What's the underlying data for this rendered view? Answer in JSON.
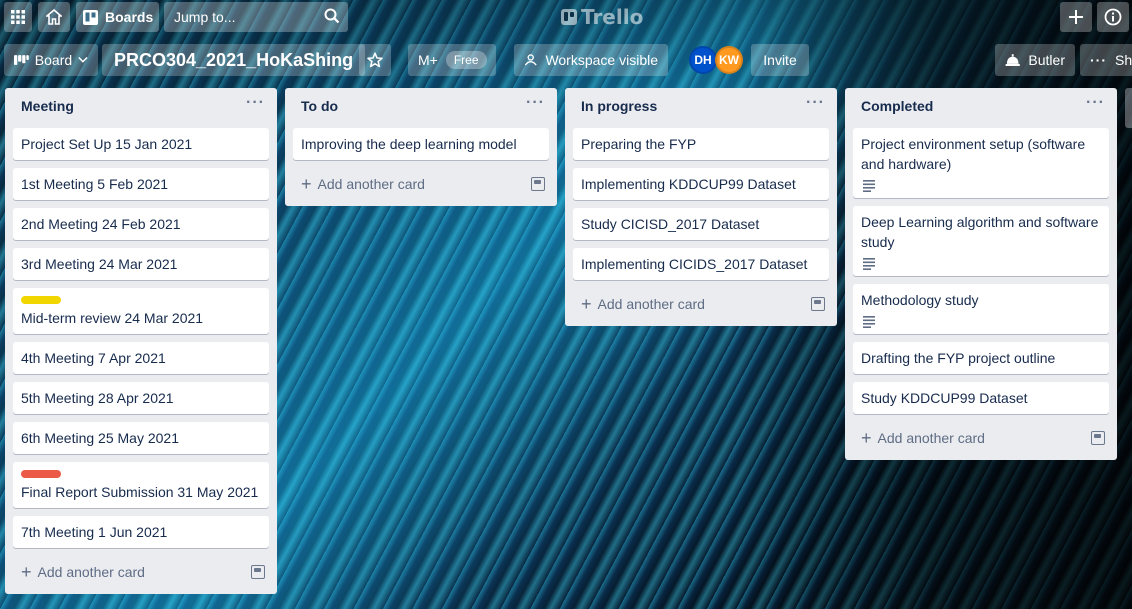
{
  "header": {
    "boards_label": "Boards",
    "search_placeholder": "Jump to...",
    "logo_text": "Trello"
  },
  "board_header": {
    "view_label": "Board",
    "title": "PRCO304_2021_HoKaShing",
    "mplus_label": "M+",
    "free_label": "Free",
    "visibility_label": "Workspace visible",
    "members": [
      {
        "initials": "DH",
        "color": "#0052cc"
      },
      {
        "initials": "KW",
        "color": "#ff991f"
      }
    ],
    "invite_label": "Invite",
    "butler_label": "Butler",
    "show_menu_label": "Sho"
  },
  "lists": [
    {
      "title": "Meeting",
      "cards": [
        {
          "title": "Project Set Up 15 Jan 2021"
        },
        {
          "title": "1st Meeting 5 Feb 2021"
        },
        {
          "title": "2nd Meeting 24 Feb 2021"
        },
        {
          "title": "3rd Meeting 24 Mar 2021"
        },
        {
          "title": "Mid-term review 24 Mar 2021",
          "label": "#f2d600"
        },
        {
          "title": "4th Meeting 7 Apr 2021"
        },
        {
          "title": "5th Meeting 28 Apr 2021"
        },
        {
          "title": "6th Meeting 25 May 2021"
        },
        {
          "title": "Final Report Submission 31 May 2021",
          "label": "#eb5a46"
        },
        {
          "title": "7th Meeting 1 Jun 2021"
        }
      ],
      "add_label": "Add another card"
    },
    {
      "title": "To do",
      "cards": [
        {
          "title": "Improving the deep learning model"
        }
      ],
      "add_label": "Add another card"
    },
    {
      "title": "In progress",
      "cards": [
        {
          "title": "Preparing the FYP"
        },
        {
          "title": "Implementing KDDCUP99 Dataset"
        },
        {
          "title": "Study CICISD_2017 Dataset"
        },
        {
          "title": "Implementing CICIDS_2017 Dataset"
        }
      ],
      "add_label": "Add another card"
    },
    {
      "title": "Completed",
      "cards": [
        {
          "title": "Project environment setup (software and hardware)",
          "has_description": true
        },
        {
          "title": "Deep Learning algorithm and software study",
          "has_description": true
        },
        {
          "title": "Methodology study",
          "has_description": true
        },
        {
          "title": "Drafting the FYP project outline"
        },
        {
          "title": "Study KDDCUP99 Dataset"
        }
      ],
      "add_label": "Add another card"
    }
  ]
}
